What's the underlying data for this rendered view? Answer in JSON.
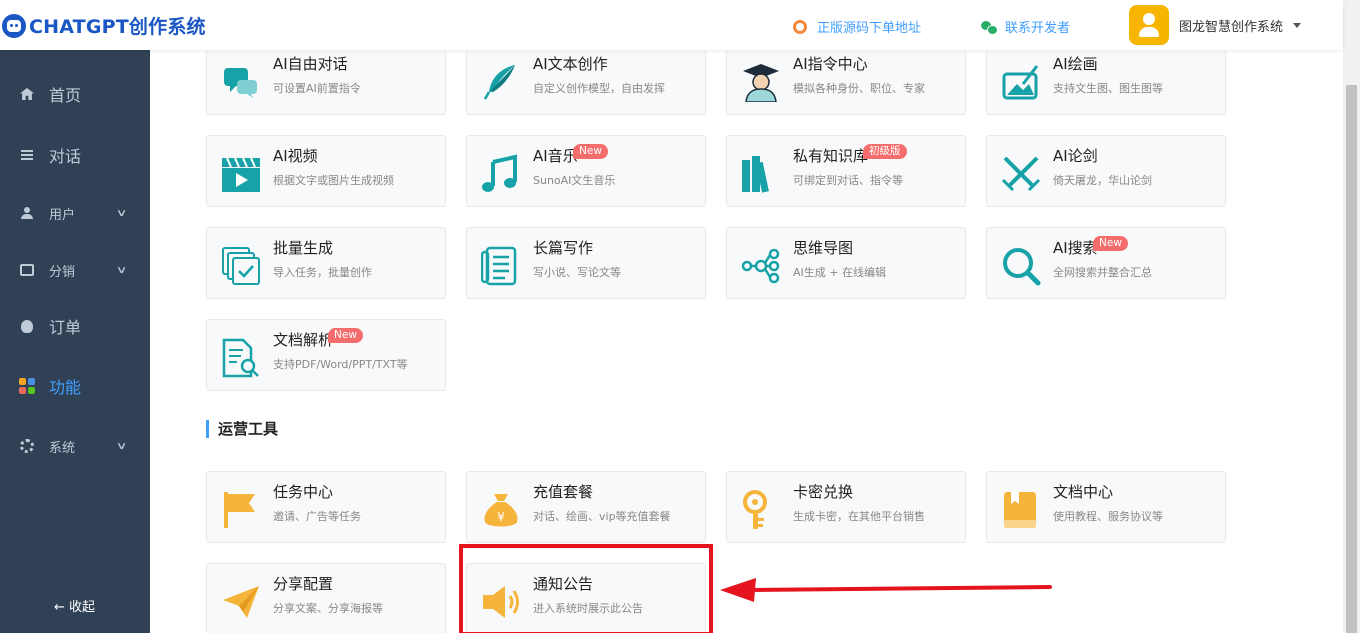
{
  "header": {
    "logo_text": "CHATGPT创作系统",
    "source_link": "正版源码下单地址",
    "dev_link": "联系开发者",
    "user_name": "图龙智慧创作系统"
  },
  "sidebar": {
    "items": [
      {
        "label": "首页",
        "icon": "home-icon"
      },
      {
        "label": "对话",
        "icon": "menu-icon"
      },
      {
        "label": "用户",
        "icon": "user-icon"
      },
      {
        "label": "分销",
        "icon": "screen-icon"
      },
      {
        "label": "订单",
        "icon": "money-bag-icon"
      },
      {
        "label": "功能",
        "icon": "grid-icon",
        "active": true
      },
      {
        "label": "系统",
        "icon": "gear-icon"
      }
    ],
    "collapse_label": "← 收起"
  },
  "features": [
    {
      "title": "AI自由对话",
      "desc": "可设置AI前置指令",
      "icon": "chat-bubbles-icon"
    },
    {
      "title": "AI文本创作",
      "desc": "自定义创作模型，自由发挥",
      "icon": "quill-icon"
    },
    {
      "title": "AI指令中心",
      "desc": "模拟各种身份、职位、专家",
      "icon": "graduate-icon"
    },
    {
      "title": "AI绘画",
      "desc": "支持文生图、图生图等",
      "icon": "painting-icon"
    },
    {
      "title": "AI视频",
      "desc": "根据文字或图片生成视频",
      "icon": "video-icon"
    },
    {
      "title": "AI音乐",
      "desc": "SunoAI文生音乐",
      "icon": "music-note-icon",
      "badge": "New"
    },
    {
      "title": "私有知识库",
      "desc": "可绑定到对话、指令等",
      "icon": "books-icon",
      "badge": "初级版"
    },
    {
      "title": "AI论剑",
      "desc": "倚天屠龙，华山论剑",
      "icon": "crossed-swords-icon"
    },
    {
      "title": "批量生成",
      "desc": "导入任务，批量创作",
      "icon": "batch-check-icon"
    },
    {
      "title": "长篇写作",
      "desc": "写小说、写论文等",
      "icon": "scroll-icon"
    },
    {
      "title": "思维导图",
      "desc": "AI生成 + 在线编辑",
      "icon": "mindmap-icon"
    },
    {
      "title": "AI搜索",
      "desc": "全网搜索并整合汇总",
      "icon": "search-icon",
      "badge": "New"
    },
    {
      "title": "文档解析",
      "desc": "支持PDF/Word/PPT/TXT等",
      "icon": "document-search-icon",
      "badge": "New"
    }
  ],
  "ops_section_title": "运营工具",
  "ops_tools": [
    {
      "title": "任务中心",
      "desc": "邀请、广告等任务",
      "icon": "flag-icon"
    },
    {
      "title": "充值套餐",
      "desc": "对话、绘画、vip等充值套餐",
      "icon": "yen-bag-icon"
    },
    {
      "title": "卡密兑换",
      "desc": "生成卡密，在其他平台销售",
      "icon": "key-icon"
    },
    {
      "title": "文档中心",
      "desc": "使用教程、服务协议等",
      "icon": "book-icon"
    },
    {
      "title": "分享配置",
      "desc": "分享文案、分享海报等",
      "icon": "paper-plane-icon"
    },
    {
      "title": "通知公告",
      "desc": "进入系统时展示此公告",
      "icon": "speaker-icon"
    }
  ],
  "colors": {
    "brand": "#1a56c4",
    "link": "#409eff",
    "sidebar_bg": "#304156",
    "teal_icon": "#17a2a8",
    "gold_icon": "#f5b43c",
    "badge": "#f56c6c",
    "annotation_red": "#e5141f"
  }
}
